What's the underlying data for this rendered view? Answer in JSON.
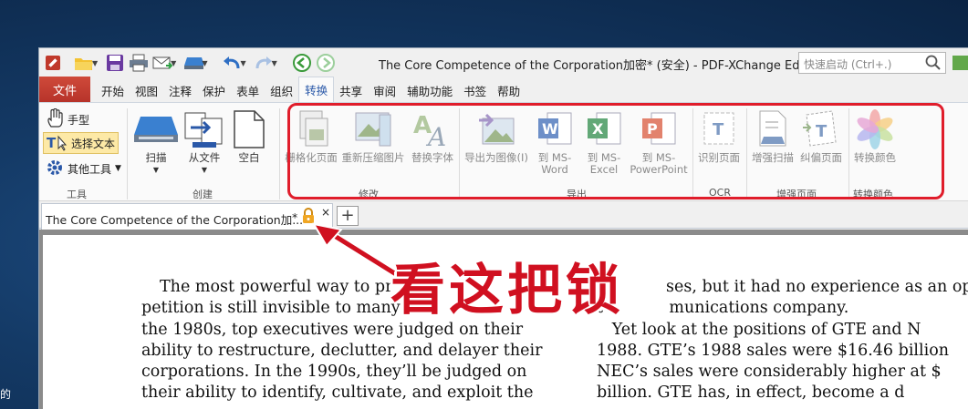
{
  "desktop": {
    "side_text": "的"
  },
  "window": {
    "title": "The Core Competence of the Corporation加密* (安全) - PDF-XChange Editor",
    "quick_search_placeholder": "快速启动 (Ctrl+.)"
  },
  "menu": {
    "file": "文件",
    "tabs": [
      "开始",
      "视图",
      "注释",
      "保护",
      "表单",
      "组织",
      "转换",
      "共享",
      "审阅",
      "辅助功能",
      "书签",
      "帮助"
    ],
    "active": "转换"
  },
  "ribbon": {
    "tools_group": {
      "label": "工具",
      "hand": "手型",
      "select_text": "选择文本",
      "other_tools": "其他工具"
    },
    "create_group": {
      "label": "创建",
      "scan": "扫描",
      "from_file": "从文件",
      "blank": "空白"
    },
    "modify_group": {
      "label": "修改",
      "rasterize": "栅格化页面",
      "recompress": "重新压缩图片",
      "replace_fonts": "替换字体"
    },
    "export_group": {
      "label": "导出",
      "export_image": "导出为图像(I)",
      "to_word_1": "到 MS-",
      "to_word_2": "Word",
      "to_excel_1": "到 MS-",
      "to_excel_2": "Excel",
      "to_ppt_1": "到 MS-",
      "to_ppt_2": "PowerPoint"
    },
    "ocr_group": {
      "label": "OCR",
      "recognize": "识别页面"
    },
    "enhance_group": {
      "label": "增强页面",
      "enhance_scan": "增强扫描",
      "deskew": "纠偏页面"
    },
    "color_group": {
      "label": "转换颜色",
      "convert_colors": "转换颜色"
    }
  },
  "doc_tab": {
    "title": "The Core Competence of the Corporation加...",
    "modified_mark": "*",
    "close": "×",
    "new_tab": "+"
  },
  "document": {
    "left_lines": [
      "The most powerful way to pr",
      "petition is still invisible to many",
      "the 1980s, top executives were judged on their",
      "ability to restructure, declutter, and delayer their",
      "corporations. In the 1990s, they’ll be judged on",
      "their ability to identify, cultivate, and exploit the"
    ],
    "right_lines": [
      "ses, but it had no experience as an ope",
      "t             munications company.",
      "   Yet look at the positions of GTE and N",
      "1988. GTE’s 1988 sales were $16.46 billion",
      "NEC’s sales were considerably higher at $",
      "billion. GTE has, in effect, become a d"
    ]
  },
  "annotation": {
    "text": "看这把锁"
  },
  "colors": {
    "file_tab": "#c0392b",
    "highlight_box": "#e01d2b",
    "annotation": "#d01020",
    "active_tab_text": "#2a58a8"
  }
}
